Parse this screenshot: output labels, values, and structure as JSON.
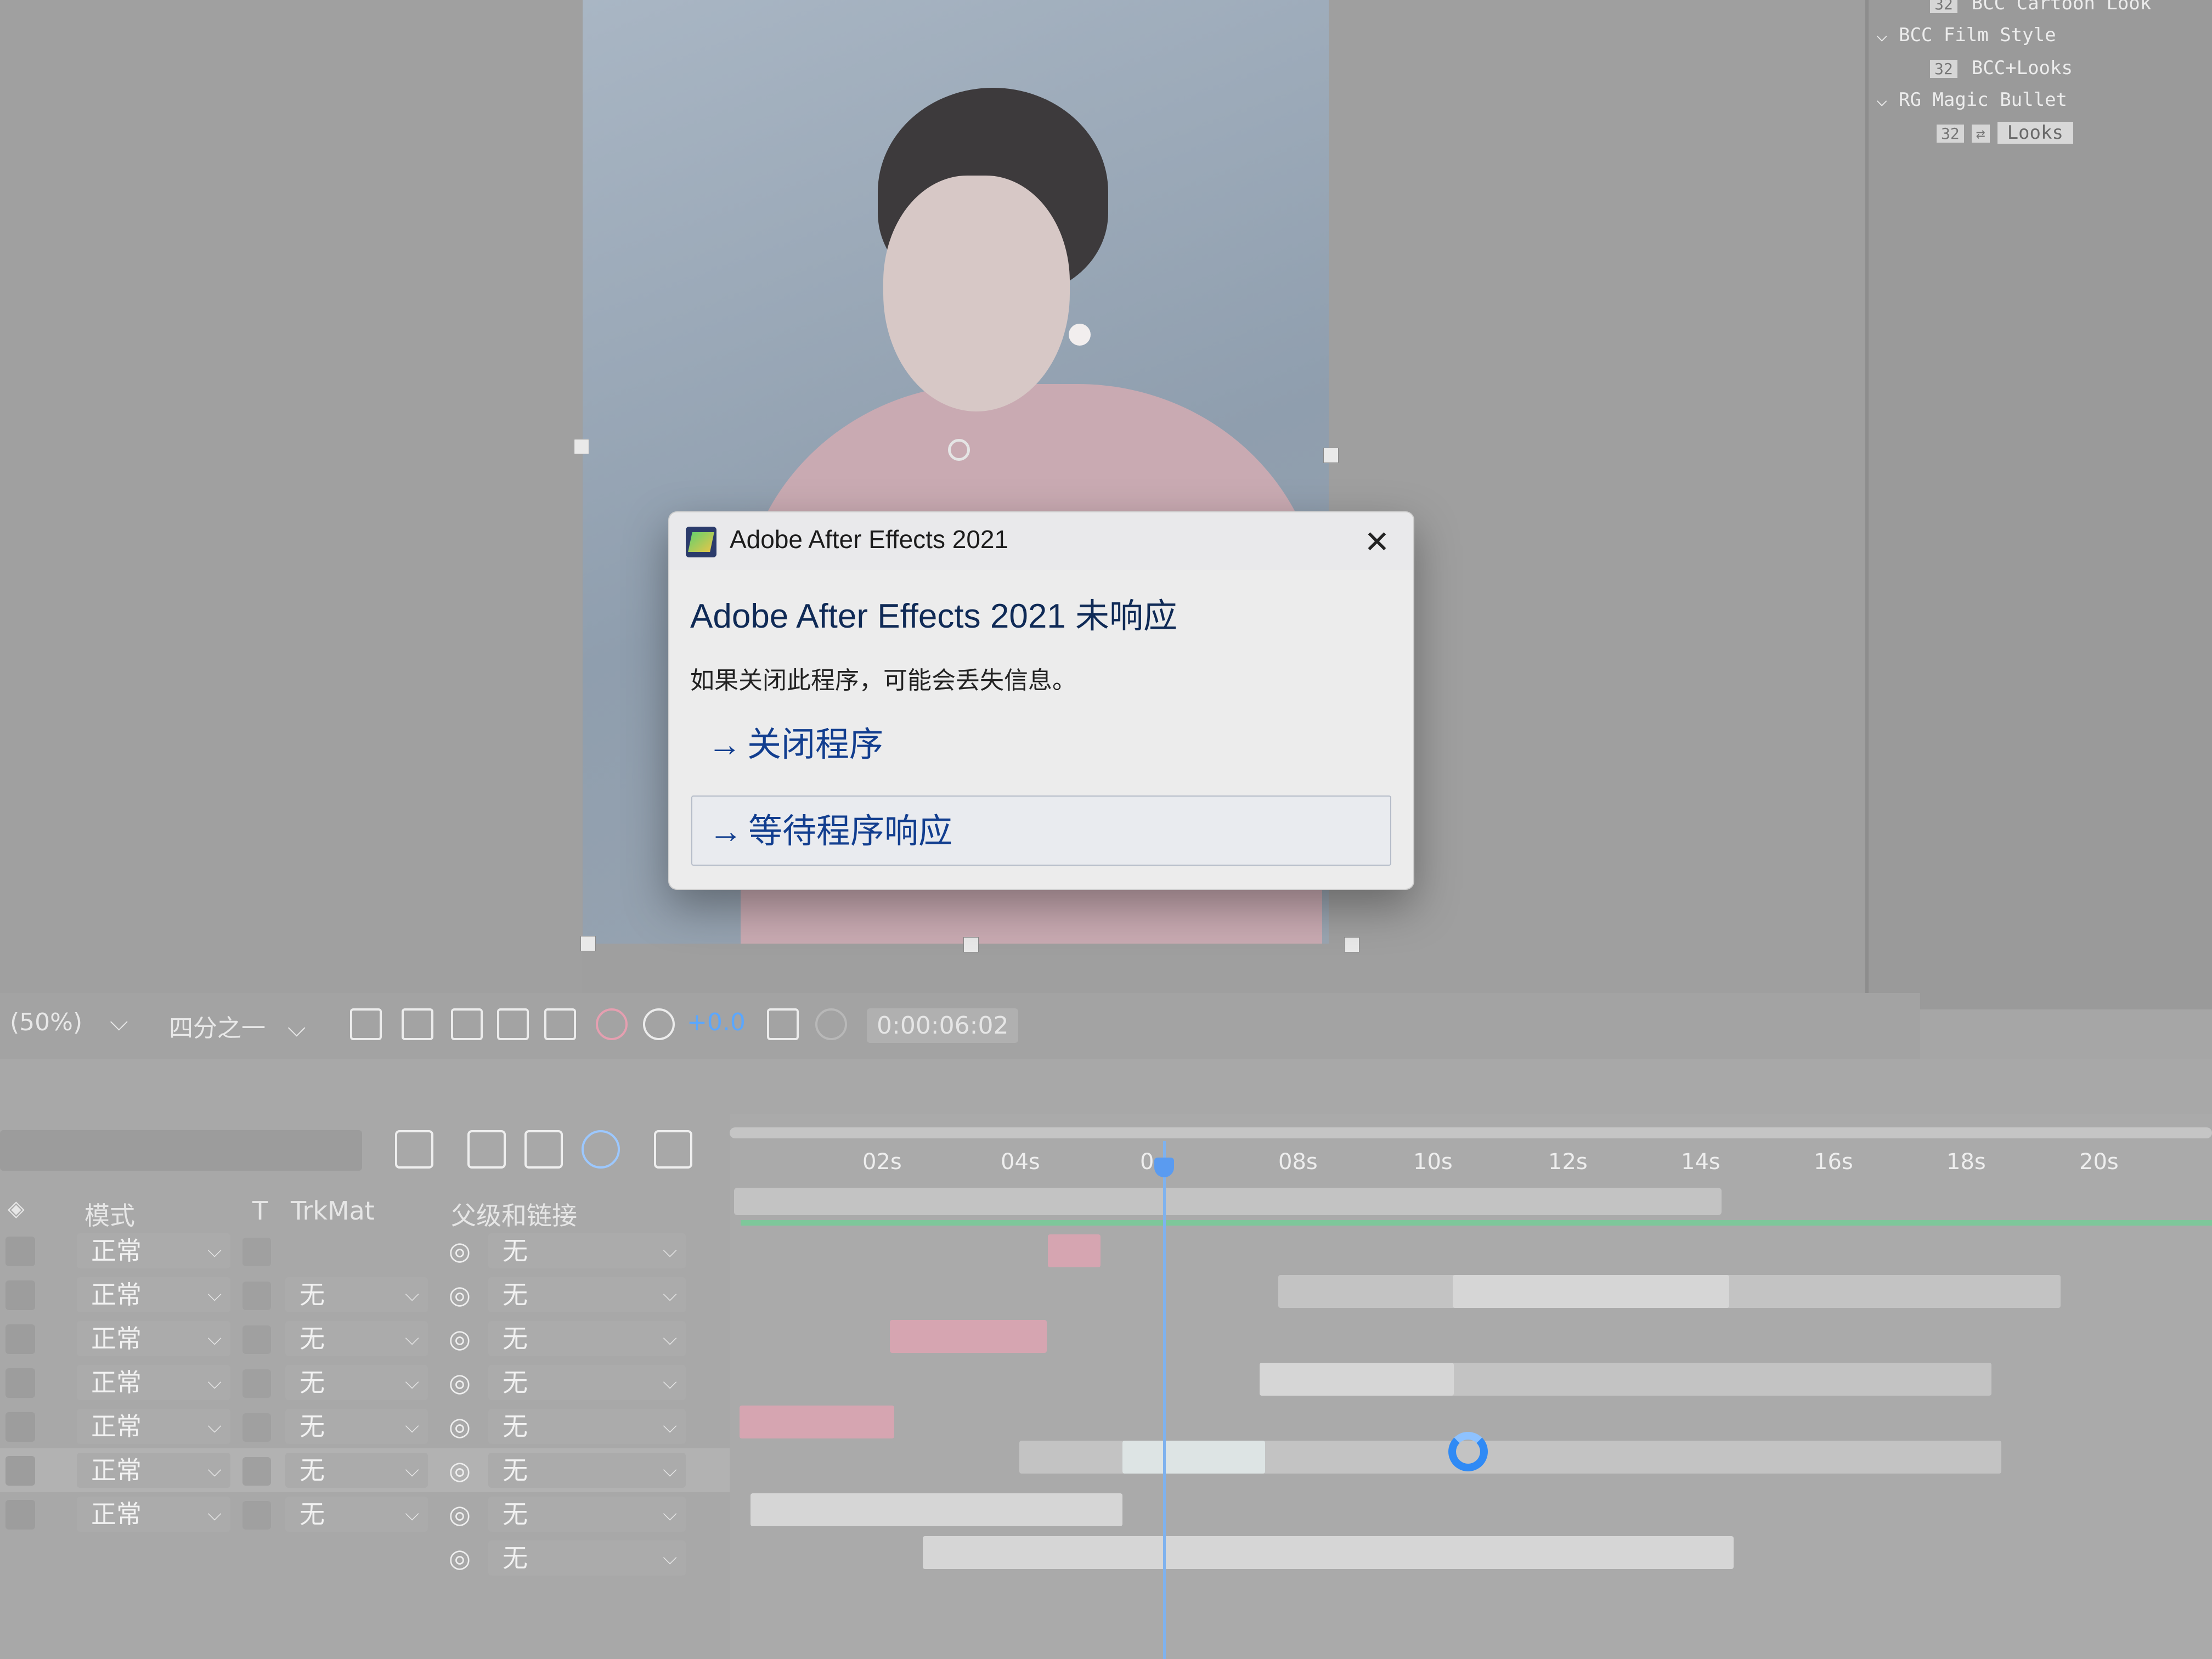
{
  "dialog": {
    "window_title": "Adobe After Effects 2021",
    "close_glyph": "✕",
    "heading": "Adobe After Effects 2021 未响应",
    "message": "如果关闭此程序，可能会丢失信息。",
    "arrow_glyph": "→",
    "options": [
      "关闭程序",
      "等待程序响应"
    ]
  },
  "effects_panel": {
    "items": [
      {
        "text": "BCC Cartoon Look",
        "badge": "32"
      },
      {
        "text": "BCC Film Style",
        "expander": "⌵"
      },
      {
        "text": "BCC+Looks",
        "badge": "32"
      },
      {
        "text": "RG Magic Bullet",
        "expander": "⌵"
      },
      {
        "text": "Looks",
        "badges": [
          "32",
          "⇄"
        ]
      }
    ]
  },
  "viewer_toolbar": {
    "magnification": "(50%)",
    "resolution": "四分之一",
    "chevron": "⌵",
    "exposure": "+0.0",
    "timecode": "0:00:06:02"
  },
  "timeline": {
    "columns": {
      "mode": "模式",
      "t": "T",
      "trkmat": "TrkMat",
      "parent": "父级和链接"
    },
    "time_ticks": [
      "02s",
      "04s",
      "0",
      "08s",
      "10s",
      "12s",
      "14s",
      "16s",
      "18s",
      "20s"
    ],
    "layers": [
      {
        "mode": "正常",
        "trkmat": "",
        "parent": "无"
      },
      {
        "mode": "正常",
        "trkmat": "无",
        "parent": "无"
      },
      {
        "mode": "正常",
        "trkmat": "无",
        "parent": "无"
      },
      {
        "mode": "正常",
        "trkmat": "无",
        "parent": "无"
      },
      {
        "mode": "正常",
        "trkmat": "无",
        "parent": "无"
      },
      {
        "mode": "正常",
        "trkmat": "无",
        "parent": "无"
      },
      {
        "mode": "正常",
        "trkmat": "无",
        "parent": "无"
      },
      {
        "mode": "",
        "trkmat": "",
        "parent": "无"
      }
    ],
    "pick_whip_glyph": "◎",
    "chevron": "⌵"
  },
  "colors": {
    "accent_blue": "#2f8af5",
    "link_blue": "#123e8f",
    "pink_bar": "#d6a5b1",
    "green_line": "#7ec79a"
  }
}
